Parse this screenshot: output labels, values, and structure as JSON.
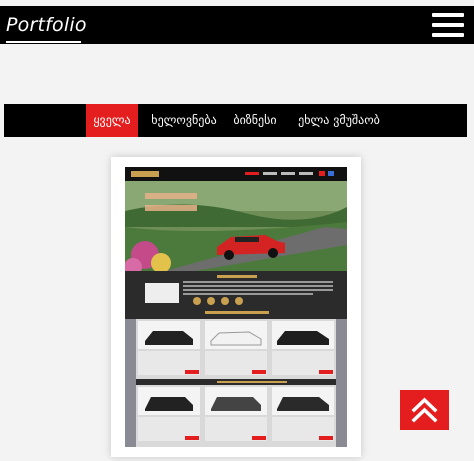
{
  "header": {
    "brand": "Portfolio",
    "menu_icon": "hamburger-menu-icon"
  },
  "filters": [
    {
      "label": "ყველა",
      "active": true
    },
    {
      "label": "ხელოვნება",
      "active": false
    },
    {
      "label": "ბიზნესი",
      "active": false
    },
    {
      "label": "ეხლა ვმუშაობ",
      "active": false
    }
  ],
  "portfolio_item": {
    "thumbnail": "car rental website screenshot"
  },
  "scroll_top_icon": "double-chevron-up-icon",
  "colors": {
    "accent": "#e41e1e",
    "bar": "#000000",
    "background": "#f3f3f3"
  }
}
